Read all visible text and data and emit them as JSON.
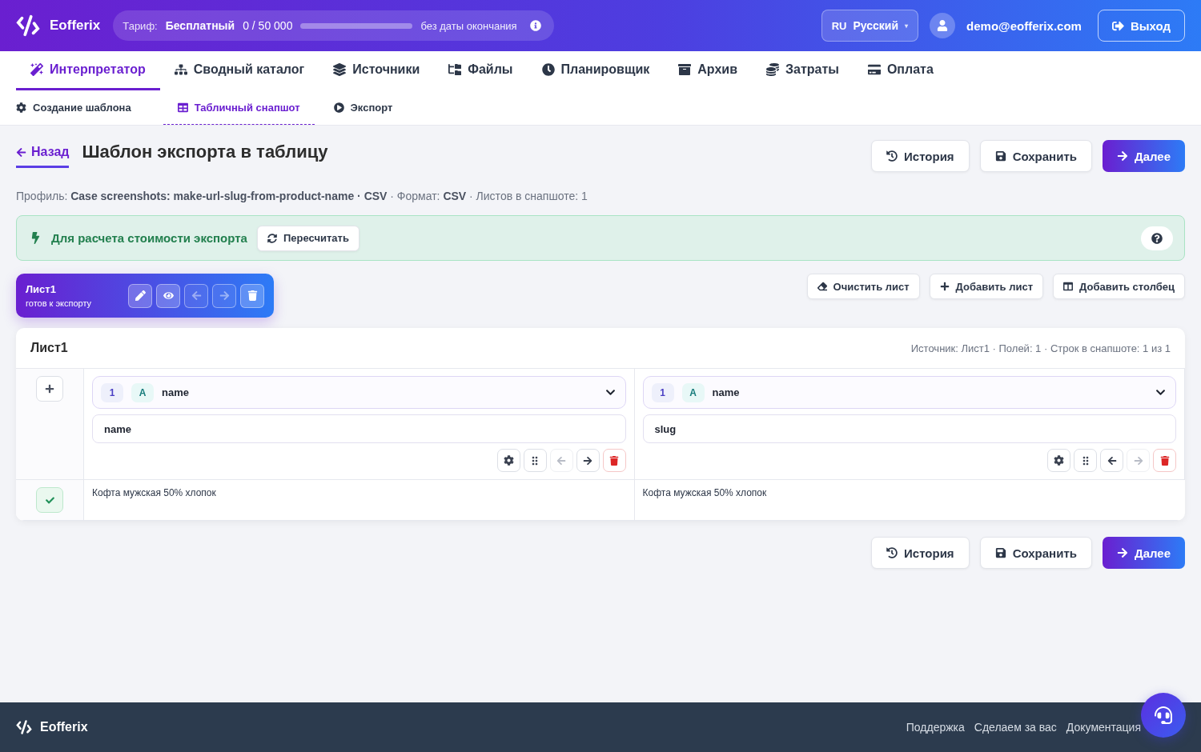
{
  "header": {
    "logo": "Eofferix",
    "plan": {
      "label": "Тариф:",
      "name": "Бесплатный",
      "usage": "0 / 50 000",
      "level": 0,
      "expiry": "без даты окончания"
    },
    "language": {
      "code": "RU",
      "name": "Русский",
      "caret": "▾"
    },
    "user": "demo@eofferix.com",
    "logout": "Выход"
  },
  "nav": [
    {
      "label": "Интерпретатор",
      "selected": true
    },
    {
      "label": "Сводный каталог",
      "selected": false
    },
    {
      "label": "Источники",
      "selected": false
    },
    {
      "label": "Файлы",
      "selected": false
    },
    {
      "label": "Планировщик",
      "selected": false
    },
    {
      "label": "Архив",
      "selected": false
    },
    {
      "label": "Затраты",
      "selected": false
    },
    {
      "label": "Оплата",
      "selected": false
    }
  ],
  "subnav": [
    {
      "label": "Создание шаблона",
      "selected": false
    },
    {
      "label": "Табличный снапшот",
      "selected": true
    },
    {
      "label": "Экспорт",
      "selected": false
    }
  ],
  "page": {
    "back": "Назад",
    "title": "Шаблон экспорта в таблицу",
    "meta": "Профиль: **Case screenshots: make-url-slug-from-product-name · CSV** · Формат: **CSV** · Листов в снапшоте: 1"
  },
  "actions_top": [
    {
      "label": "История",
      "kind": "history"
    },
    {
      "label": "Сохранить",
      "kind": "save"
    },
    {
      "label": "Далее",
      "kind": "next"
    }
  ],
  "notice": {
    "text": "Для расчета стоимости экспорта",
    "button": "Пересчитать"
  },
  "sheet_tab": {
    "name": "Лист1",
    "status": "готов к экспорту",
    "tools": [
      {
        "kind": "edit",
        "disabled": false
      },
      {
        "kind": "view",
        "disabled": false
      },
      {
        "kind": "left",
        "disabled": true
      },
      {
        "kind": "right",
        "disabled": true
      },
      {
        "kind": "delete",
        "disabled": false
      }
    ]
  },
  "sheet_toolbar": [
    {
      "label": "Очистить лист",
      "kind": "clear"
    },
    {
      "label": "Добавить лист",
      "kind": "add"
    },
    {
      "label": "Добавить столбец",
      "kind": "column"
    }
  ],
  "table": {
    "title": "Лист1",
    "info": "Источник: Лист1 · Полей: 1 · Строк в снапшоте: 1 из 1",
    "columns": [
      {
        "index": "1",
        "letter": "A",
        "source": "name",
        "header": "name",
        "left_disabled": true,
        "right_disabled": false
      },
      {
        "index": "1",
        "letter": "A",
        "source": "name",
        "header": "slug",
        "left_disabled": false,
        "right_disabled": true
      }
    ],
    "rows": [
      {
        "checked": true,
        "cells": [
          "Кофта мужская 50% хлопок",
          "Кофта мужская 50% хлопок"
        ]
      }
    ]
  },
  "actions_bottom": [
    {
      "label": "История",
      "kind": "history"
    },
    {
      "label": "Сохранить",
      "kind": "save"
    },
    {
      "label": "Далее",
      "kind": "next"
    }
  ],
  "footer": {
    "logo": "Eofferix",
    "links": [
      "Поддержка",
      "Сделаем за вас",
      "Документация"
    ]
  }
}
